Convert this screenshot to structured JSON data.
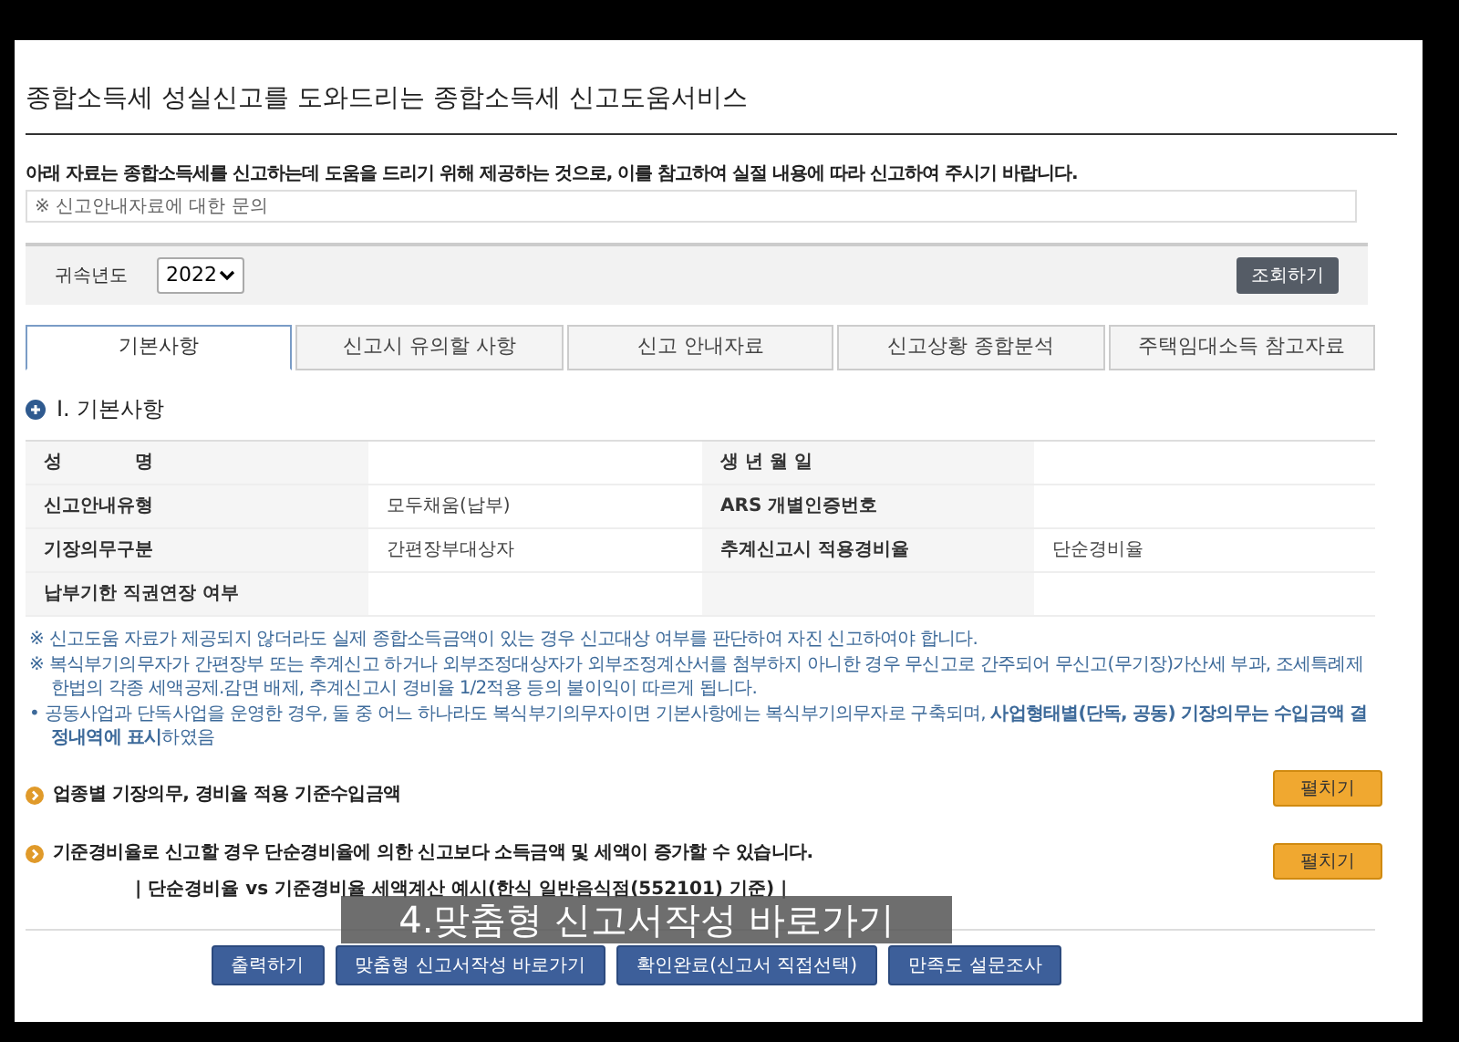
{
  "page_title": "종합소득세 성실신고를 도와드리는 종합소득세 신고도움서비스",
  "notice": "아래 자료는 종합소득세를 신고하는데 도움을 드리기 위해 제공하는 것으로, 이를 참고하여 실절 내용에 따라 신고하여 주시기 바랍니다.",
  "inquiry": "※ 신고안내자료에 대한 문의",
  "search": {
    "label": "귀속년도",
    "year": "2022",
    "button": "조회하기"
  },
  "tabs": [
    {
      "label": "기본사항",
      "selected": true
    },
    {
      "label": "신고시 유의할 사항",
      "selected": false
    },
    {
      "label": "신고 안내자료",
      "selected": false
    },
    {
      "label": "신고상황 종합분석",
      "selected": false
    },
    {
      "label": "주택임대소득 참고자료",
      "selected": false
    }
  ],
  "section_heading": "Ⅰ. 기본사항",
  "table_rows": [
    [
      "성　　　　명",
      "",
      "생 년 월 일",
      ""
    ],
    [
      "신고안내유형",
      "모두채움(납부)",
      "ARS 개별인증번호",
      ""
    ],
    [
      "기장의무구분",
      "간편장부대상자",
      "추계신고시 적용경비율",
      "단순경비율"
    ],
    [
      "납부기한 직권연장 여부",
      "",
      "",
      ""
    ]
  ],
  "notes": [
    "※ 신고도움 자료가 제공되지 않더라도 실제 종합소득금액이 있는 경우 신고대상 여부를 판단하여 자진 신고하여야 합니다.",
    "※ 복식부기의무자가 간편장부 또는 추계신고 하거나 외부조정대상자가 외부조정계산서를 첨부하지 아니한 경우 무신고로 간주되어 무신고(무기장)가산세 부과, 조세특례제한법의 각종 세액공제.감면 배제, 추계신고시 경비율 1/2적용 등의 불이익이 따르게 됩니다.",
    "• 공동사업과 단독사업을 운영한 경우, 둘 중 어느 하나라도 복식부기의무자이면 기본사항에는 복식부기의무자로 구축되며, **사업형태별(단독, 공동) 기장의무는 수입금액 결정내역에 표시**하였음"
  ],
  "expanders": [
    {
      "title": "업종별 기장의무, 경비율 적용 기준수입금액",
      "button": "펼치기"
    },
    {
      "title": "기준경비율로 신고할 경우 단순경비율에 의한 신고보다 소득금액 및 세액이 증가할 수 있습니다.",
      "button": "펼치기",
      "sub": "| 단순경비율 vs 기준경비율 세액계산 예시(한식 일반음식점(552101) 기준) |"
    }
  ],
  "actions": [
    "출력하기",
    "맞춤형 신고서작성 바로가기",
    "확인완료(신고서 직접선택)",
    "만족도 설문조사"
  ],
  "caption": "4.맞춤형 신고서작성 바로가기"
}
